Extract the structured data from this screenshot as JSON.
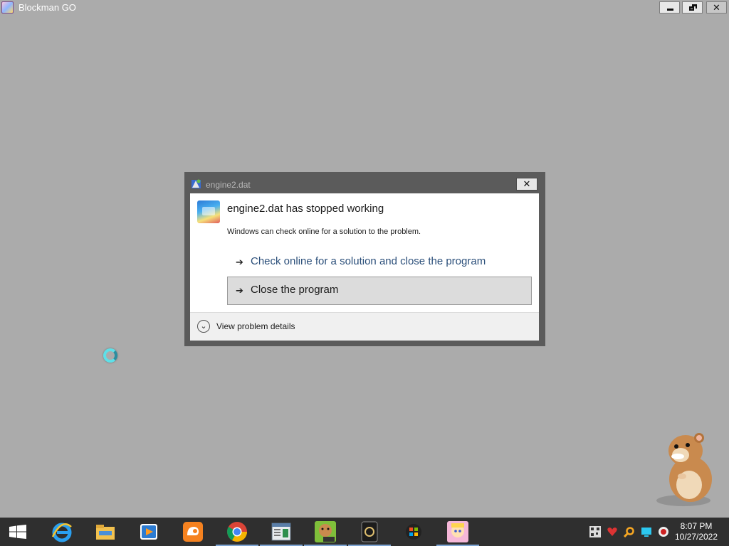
{
  "window": {
    "title": "Blockman GO",
    "close_glyph": "✕"
  },
  "dialog": {
    "title": "engine2.dat",
    "close_glyph": "✕",
    "heading": "engine2.dat has stopped working",
    "message": "Windows can check online for a solution to the problem.",
    "options": [
      {
        "label": "Check online for a solution and close the program",
        "icon": "arrow-right-icon"
      },
      {
        "label": "Close the program",
        "icon": "arrow-right-icon"
      }
    ],
    "details_label": "View problem details",
    "arrow_glyph": "➔",
    "chevron_glyph": "⌄"
  },
  "taskbar": {
    "apps": [
      {
        "name": "internet-explorer-icon",
        "running": false
      },
      {
        "name": "file-explorer-icon",
        "running": false
      },
      {
        "name": "media-player-icon",
        "running": false
      },
      {
        "name": "uc-browser-icon",
        "running": false
      },
      {
        "name": "chrome-icon",
        "running": true
      },
      {
        "name": "document-app-icon",
        "running": true
      },
      {
        "name": "box-app-icon",
        "running": true
      },
      {
        "name": "game-engine-icon",
        "running": true
      },
      {
        "name": "windows-logo-app-icon",
        "running": false
      },
      {
        "name": "blockman-go-icon",
        "running": true
      }
    ],
    "tray": [
      "qr-tray-icon",
      "heart-tray-icon",
      "search-tray-icon",
      "monitor-tray-icon",
      "record-tray-icon"
    ],
    "time": "8:07 PM",
    "date": "10/27/2022"
  },
  "colors": {
    "desktop": "#ababab",
    "taskbar": "#2f2f2f",
    "link_text": "#2b4f7a"
  }
}
